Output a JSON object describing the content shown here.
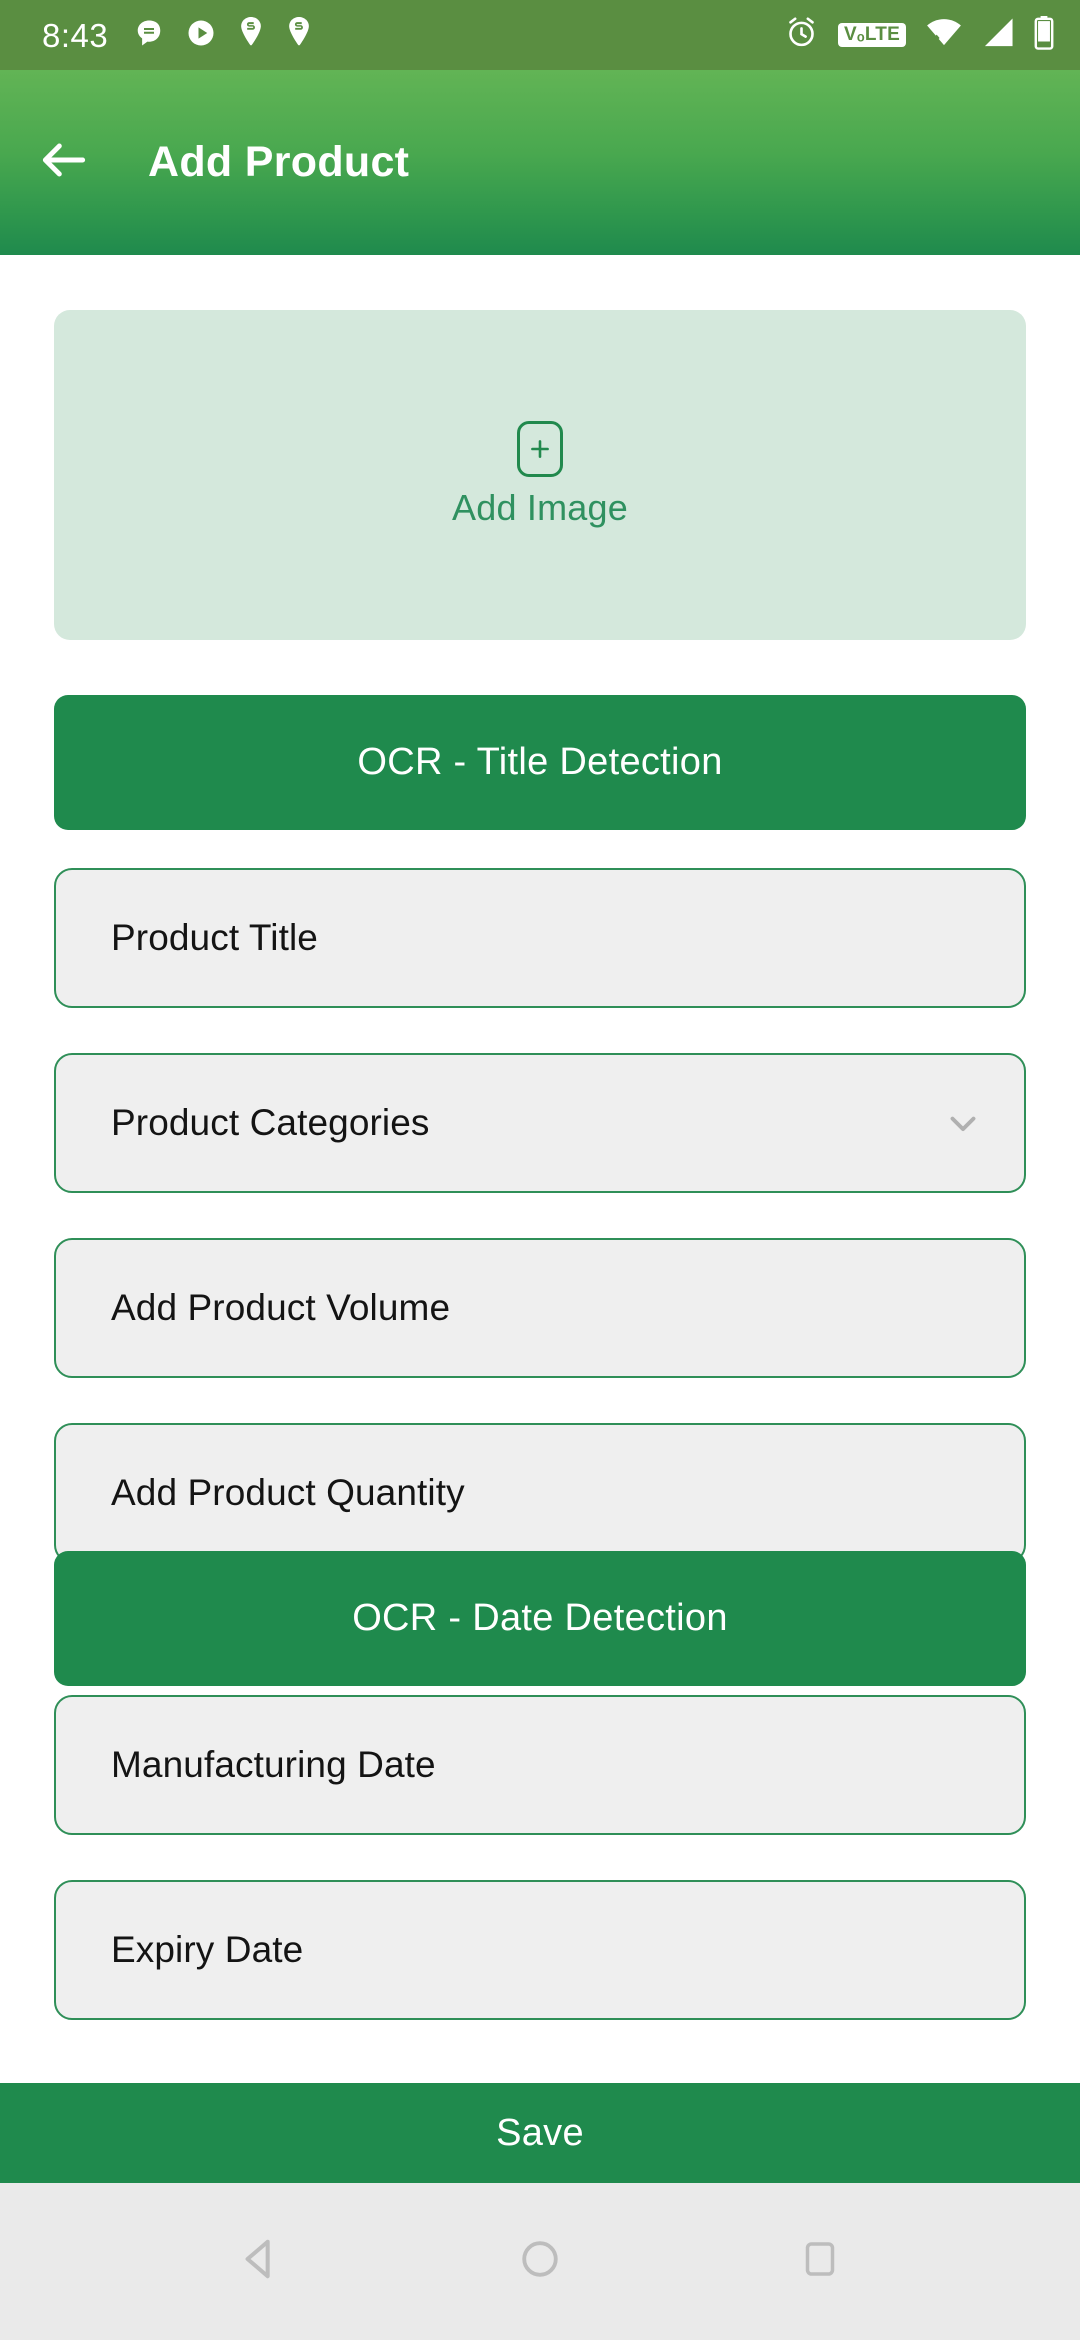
{
  "status_bar": {
    "time": "8:43",
    "left_icons": [
      "message-icon",
      "play-circle-icon",
      "swiggy-icon",
      "swiggy-icon"
    ],
    "right_icons": [
      "alarm-icon",
      "volte-icon",
      "wifi-icon",
      "cellular-signal-icon",
      "battery-icon"
    ],
    "volte_label": "VₒLTE",
    "background_color": "#5a8e41"
  },
  "app_bar": {
    "back_icon": "arrow-left-icon",
    "title": "Add Product",
    "gradient_from": "#62b455",
    "gradient_to": "#1f8a4d"
  },
  "image_picker": {
    "icon": "plus-in-rounded-square-icon",
    "label": "Add Image",
    "background_color": "#d4e8dc",
    "accent_color": "#2f9160"
  },
  "buttons": {
    "ocr_title": "OCR - Title Detection",
    "ocr_date": "OCR - Date Detection",
    "save": "Save",
    "color": "#1f8a4d"
  },
  "fields": {
    "title": {
      "label": "Product Title",
      "value": "",
      "placeholder": "Product Title"
    },
    "category": {
      "label": "Product Categories",
      "value": "",
      "placeholder": "Product Categories",
      "chevron": "chevron-down-icon"
    },
    "volume": {
      "label": "Add Product Volume",
      "value": "",
      "placeholder": "Add Product Volume"
    },
    "quantity": {
      "label": "Add Product Quantity",
      "value": "",
      "placeholder": "Add Product Quantity"
    },
    "manufacturing_date": {
      "label": "Manufacturing Date",
      "value": "",
      "placeholder": "Manufacturing Date"
    },
    "expiry_date": {
      "label": "Expiry Date",
      "value": "",
      "placeholder": "Expiry Date"
    },
    "fill_color": "#efefef",
    "border_color": "#2f8f58",
    "text_color": "#141414"
  },
  "nav_bar": {
    "items": [
      "back-triangle-icon",
      "home-circle-icon",
      "recents-square-icon"
    ],
    "background_color": "#eaeaea",
    "icon_color": "#bdbdbd"
  }
}
